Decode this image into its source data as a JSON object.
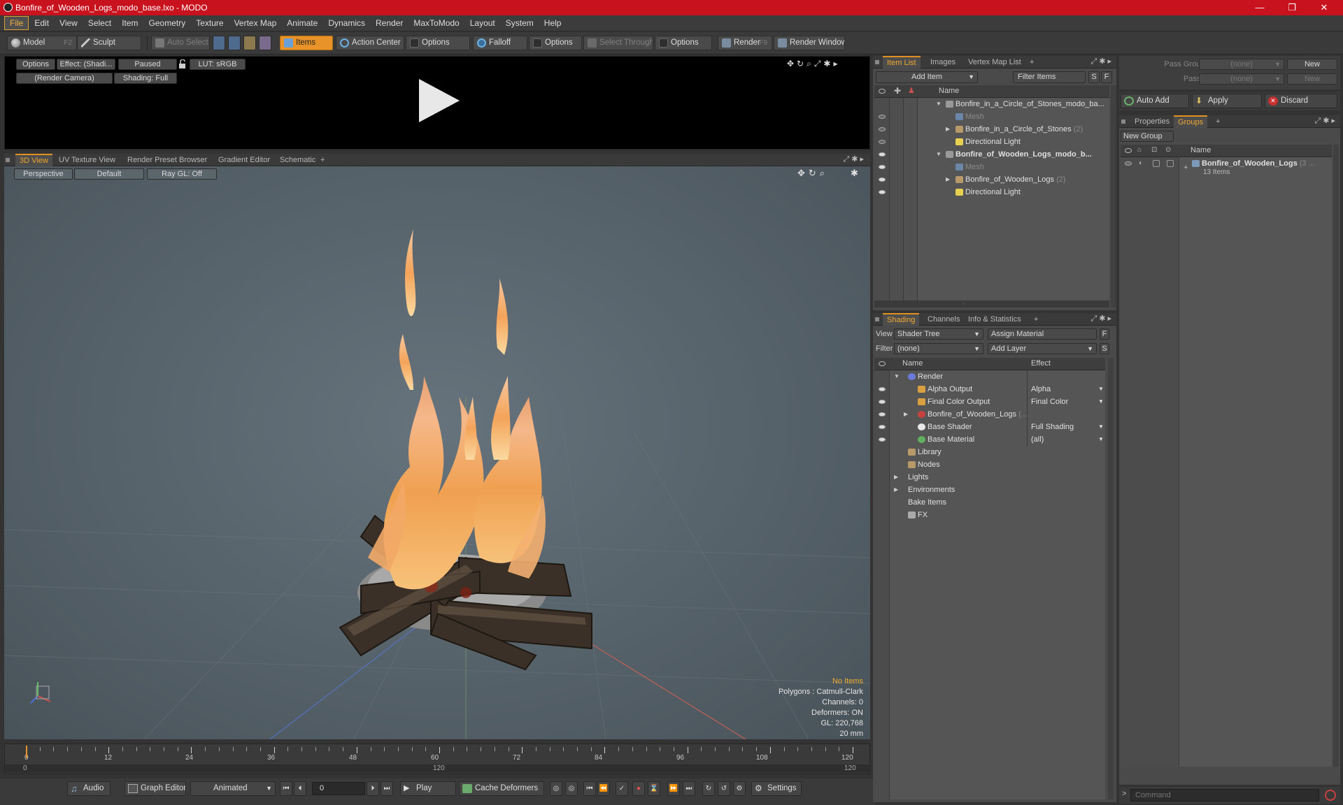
{
  "window": {
    "title": "Bonfire_of_Wooden_Logs_modo_base.lxo - MODO",
    "minimize": "—",
    "maximize": "❐",
    "close": "✕"
  },
  "menu": [
    "File",
    "Edit",
    "View",
    "Select",
    "Item",
    "Geometry",
    "Texture",
    "Vertex Map",
    "Animate",
    "Dynamics",
    "Render",
    "MaxToModo",
    "Layout",
    "System",
    "Help"
  ],
  "toolbar": {
    "model": "Model",
    "model_key": "F2",
    "sculpt": "Sculpt",
    "auto_select": "Auto Select",
    "items": "Items",
    "action_center": "Action Center",
    "options1": "Options",
    "falloff": "Falloff",
    "options2": "Options",
    "select_through": "Select Through",
    "options3": "Options",
    "render": "Render",
    "render_key": "F9",
    "render_window": "Render Window"
  },
  "preview": {
    "options": "Options",
    "effect": "Effect: (Shadi...",
    "paused": "Paused",
    "lut": "LUT: sRGB",
    "camera": "(Render Camera)",
    "shading": "Shading: Full"
  },
  "viewport_tabs": [
    "3D View",
    "UV Texture View",
    "Render Preset Browser",
    "Gradient Editor",
    "Schematic",
    "+"
  ],
  "viewport": {
    "perspective": "Perspective",
    "default": "Default",
    "raygl": "Ray GL: Off",
    "stats": {
      "no_items": "No Items",
      "polygons": "Polygons : Catmull-Clark",
      "channels": "Channels: 0",
      "deformers": "Deformers: ON",
      "gl": "GL: 220,768",
      "scale": "20 mm"
    }
  },
  "timeline": {
    "labels": [
      "0",
      "12",
      "24",
      "36",
      "48",
      "60",
      "72",
      "84",
      "96",
      "108",
      "120"
    ],
    "range_start": "0",
    "range_mid": "120",
    "range_end": "120"
  },
  "bottombar": {
    "audio": "Audio",
    "graph_editor": "Graph Editor",
    "animated": "Animated",
    "frame": "0",
    "play": "Play",
    "cache_deformers": "Cache Deformers",
    "settings": "Settings"
  },
  "item_list": {
    "tabs": [
      "Item List",
      "Images",
      "Vertex Map List",
      "+"
    ],
    "add_item": "Add Item",
    "filter_items": "Filter Items",
    "s": "S",
    "f": "F",
    "col_name": "Name",
    "rows": [
      {
        "label": "Bonfire_in_a_Circle_of_Stones_modo_ba...",
        "count": ""
      },
      {
        "label": "Mesh",
        "count": ""
      },
      {
        "label": "Bonfire_in_a_Circle_of_Stones",
        "count": "(2)"
      },
      {
        "label": "Directional Light",
        "count": ""
      },
      {
        "label": "Bonfire_of_Wooden_Logs_modo_b...",
        "count": ""
      },
      {
        "label": "Mesh",
        "count": ""
      },
      {
        "label": "Bonfire_of_Wooden_Logs",
        "count": "(2)"
      },
      {
        "label": "Directional Light",
        "count": ""
      }
    ]
  },
  "shading": {
    "tabs": [
      "Shading",
      "Channels",
      "Info & Statistics",
      "+"
    ],
    "view_label": "View",
    "view_value": "Shader Tree",
    "assign_material": "Assign Material",
    "filter_label": "Filter",
    "filter_value": "(none)",
    "add_layer": "Add Layer",
    "f": "F",
    "s": "S",
    "col_name": "Name",
    "col_effect": "Effect",
    "rows": [
      {
        "label": "Render",
        "effect": ""
      },
      {
        "label": "Alpha Output",
        "effect": "Alpha"
      },
      {
        "label": "Final Color Output",
        "effect": "Final Color"
      },
      {
        "label": "Bonfire_of_Wooden_Logs",
        "effect": "(..."
      },
      {
        "label": "Base Shader",
        "effect": "Full Shading"
      },
      {
        "label": "Base Material",
        "effect": "(all)"
      },
      {
        "label": "Library",
        "effect": ""
      },
      {
        "label": "Nodes",
        "effect": ""
      },
      {
        "label": "Lights",
        "effect": ""
      },
      {
        "label": "Environments",
        "effect": ""
      },
      {
        "label": "Bake Items",
        "effect": ""
      },
      {
        "label": "FX",
        "effect": ""
      }
    ]
  },
  "groups": {
    "pass_groups_label": "Pass Groups",
    "pass_groups_value": "(none)",
    "passes_label": "Passes",
    "passes_value": "(none)",
    "new1": "New",
    "new2": "New",
    "auto_add": "Auto Add",
    "apply": "Apply",
    "discard": "Discard",
    "tabs": [
      "Properties",
      "Groups",
      "+"
    ],
    "new_group": "New Group",
    "col_name": "Name",
    "group_name": "Bonfire_of_Wooden_Logs",
    "group_count": "(3 ...",
    "group_items": "13 Items"
  },
  "command": {
    "placeholder": "Command"
  },
  "colors": {
    "accent": "#e8932a",
    "titlebar": "#c8131f"
  }
}
